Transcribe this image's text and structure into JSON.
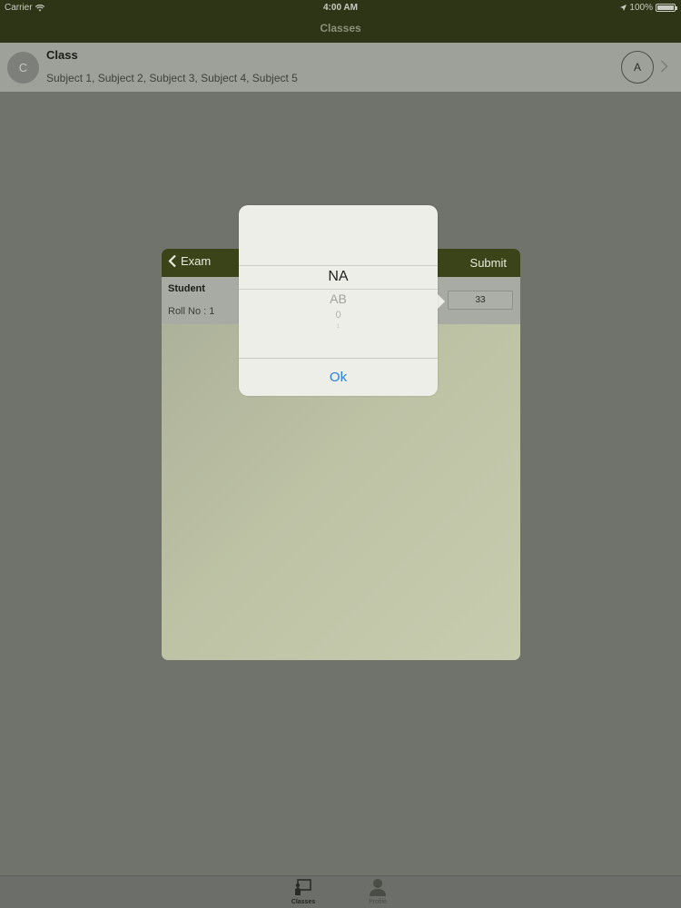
{
  "status_bar": {
    "carrier": "Carrier",
    "time": "4:00 AM",
    "battery": "100%"
  },
  "nav": {
    "title": "Classes"
  },
  "class_row": {
    "avatar_letter": "C",
    "title": "Class",
    "subjects": "Subject 1, Subject 2, Subject 3, Subject 4, Subject 5",
    "attendance_letter": "A"
  },
  "exam_modal": {
    "back_label": "Exam",
    "submit_label": "Submit",
    "student": {
      "name": "Student",
      "roll_no": "Roll No : 1",
      "marks_value": "33"
    }
  },
  "picker": {
    "options": [
      "NA",
      "AB",
      "0",
      "1"
    ],
    "selected": "NA",
    "ok_label": "Ok"
  },
  "tabbar": {
    "tabs": [
      {
        "label": "Classes",
        "icon": "classroom-icon",
        "active": true
      },
      {
        "label": "Profile",
        "icon": "person-icon",
        "active": false
      }
    ]
  },
  "colors": {
    "nav_bar": "#2e3516",
    "exam_header": "#3b4419",
    "accent_blue": "#2b7ee0"
  }
}
